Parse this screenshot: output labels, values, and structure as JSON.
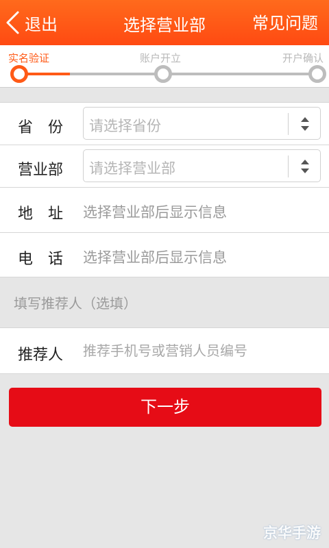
{
  "header": {
    "back_label": "退出",
    "title": "选择营业部",
    "faq_label": "常见问题",
    "color": "#ff5a17"
  },
  "progress": {
    "steps": [
      "实名验证",
      "账户开立",
      "开户确认"
    ],
    "active_step": 1,
    "fill_fraction": 0.17,
    "active_color": "#ff5a17",
    "inactive_color": "#bdbdbd"
  },
  "form": {
    "province": {
      "label": "省　份",
      "placeholder": "请选择省份",
      "icon": "sort-icon"
    },
    "branch": {
      "label": "营业部",
      "placeholder": "请选择营业部",
      "icon": "sort-icon"
    },
    "address": {
      "label": "地　址",
      "value": "选择营业部后显示信息"
    },
    "phone": {
      "label": "电　话",
      "value": "选择营业部后显示信息"
    },
    "referrer_section": "填写推荐人（选填）",
    "referrer": {
      "label": "推荐人",
      "placeholder": "推荐手机号或营销人员编号",
      "value": ""
    }
  },
  "next_button": {
    "label": "下一步",
    "color": "#e60c16"
  },
  "watermark": "京华手游"
}
